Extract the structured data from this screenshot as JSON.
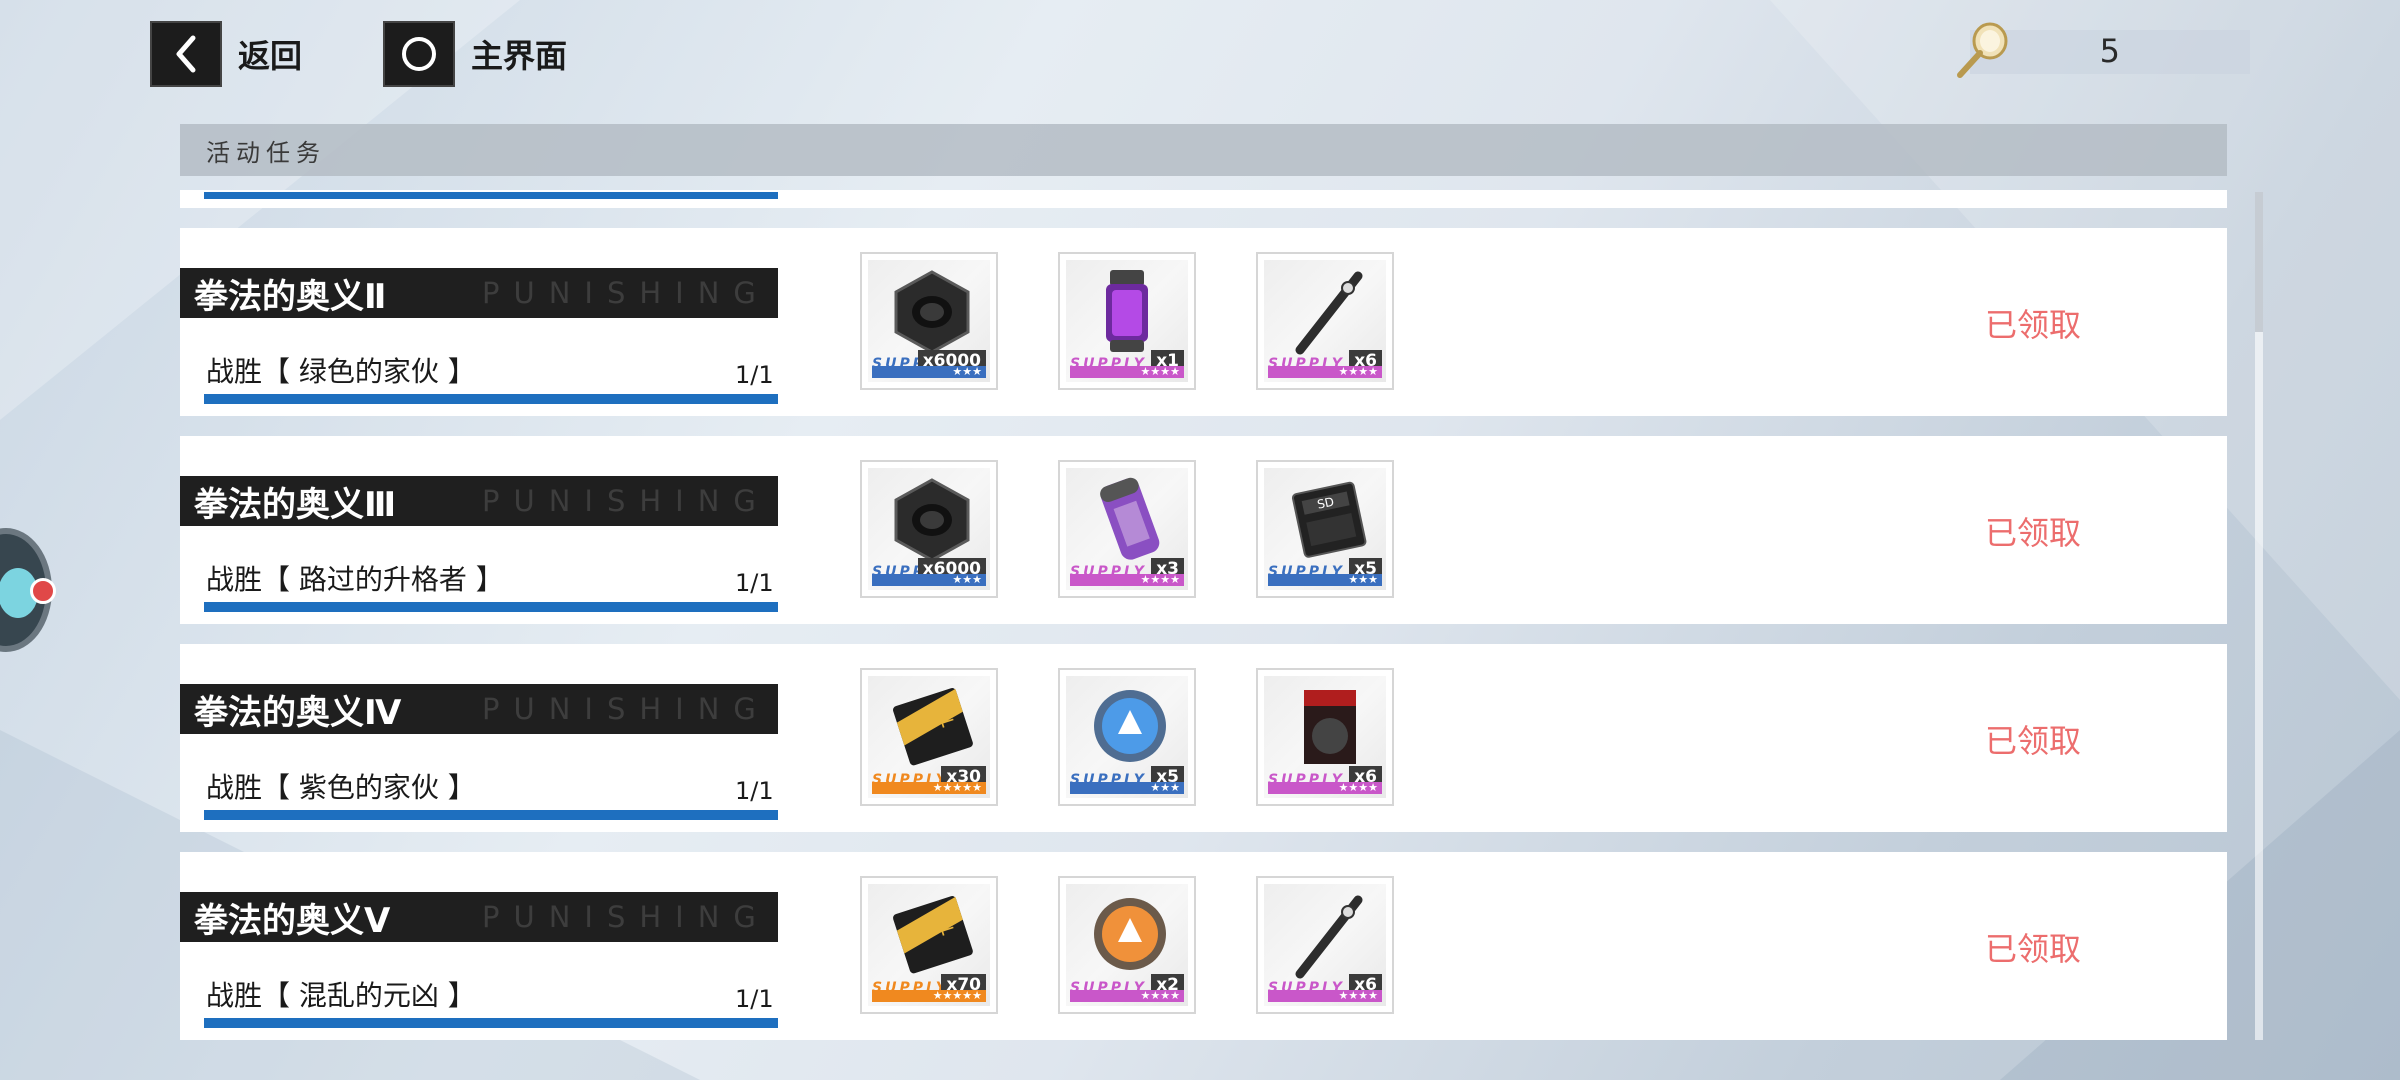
{
  "nav": {
    "back_label": "返回",
    "back_icon": "chevron-left-icon",
    "home_label": "主界面",
    "home_icon": "circle-icon"
  },
  "currency": {
    "icon": "hand-mirror-icon",
    "value": "5"
  },
  "section": {
    "title": "活动任务"
  },
  "tasks": [
    {
      "title": "拳法的奥义Ⅱ",
      "watermark": "PUNISHING",
      "condition": "战胜【 绿色的家伙 】",
      "progress": "1/1",
      "progress_fraction": 1,
      "status": "已领取",
      "rewards": [
        {
          "icon": "hex-nut-icon",
          "supply": "SUPPLY",
          "qty": "x6000",
          "stars": "★★★",
          "rarity_color": "#3a6fbf"
        },
        {
          "icon": "purple-energy-canister-icon",
          "supply": "SUPPLY",
          "qty": "x1",
          "stars": "★★★★",
          "rarity_color": "#c957c9"
        },
        {
          "icon": "metal-rod-icon",
          "supply": "SUPPLY",
          "qty": "x6",
          "stars": "★★★★",
          "rarity_color": "#c957c9"
        }
      ]
    },
    {
      "title": "拳法的奥义Ⅲ",
      "watermark": "PUNISHING",
      "condition": "战胜【 路过的升格者 】",
      "progress": "1/1",
      "progress_fraction": 1,
      "status": "已领取",
      "rewards": [
        {
          "icon": "hex-nut-icon",
          "supply": "SUPPLY",
          "qty": "x6000",
          "stars": "★★★",
          "rarity_color": "#3a6fbf"
        },
        {
          "icon": "purple-capsule-icon",
          "supply": "SUPPLY",
          "qty": "x3",
          "stars": "★★★★",
          "rarity_color": "#c957c9"
        },
        {
          "icon": "sd-chip-icon",
          "supply": "SUPPLY",
          "qty": "x5",
          "stars": "★★★",
          "rarity_color": "#3a6fbf"
        }
      ]
    },
    {
      "title": "拳法的奥义Ⅳ",
      "watermark": "PUNISHING",
      "condition": "战胜【 紫色的家伙 】",
      "progress": "1/1",
      "progress_fraction": 1,
      "status": "已领取",
      "rewards": [
        {
          "icon": "gold-card-icon",
          "supply": "SUPPLY",
          "qty": "x30",
          "stars": "★★★★★",
          "rarity_color": "#f0891f"
        },
        {
          "icon": "blue-coin-icon",
          "supply": "SUPPLY",
          "qty": "x5",
          "stars": "★★★",
          "rarity_color": "#3a6fbf"
        },
        {
          "icon": "poster-card-icon",
          "supply": "SUPPLY",
          "qty": "x6",
          "stars": "★★★★",
          "rarity_color": "#c957c9"
        }
      ]
    },
    {
      "title": "拳法的奥义Ⅴ",
      "watermark": "PUNISHING",
      "condition": "战胜【 混乱的元凶 】",
      "progress": "1/1",
      "progress_fraction": 1,
      "status": "已领取",
      "rewards": [
        {
          "icon": "gold-card-icon",
          "supply": "SUPPLY",
          "qty": "x70",
          "stars": "★★★★★",
          "rarity_color": "#f0891f"
        },
        {
          "icon": "orange-coin-icon",
          "supply": "SUPPLY",
          "qty": "x2",
          "stars": "★★★★",
          "rarity_color": "#c957c9"
        },
        {
          "icon": "metal-rod-icon",
          "supply": "SUPPLY",
          "qty": "x6",
          "stars": "★★★★",
          "rarity_color": "#c957c9"
        }
      ]
    }
  ],
  "floating_assistant": {
    "icon": "assistant-mascot-icon"
  }
}
